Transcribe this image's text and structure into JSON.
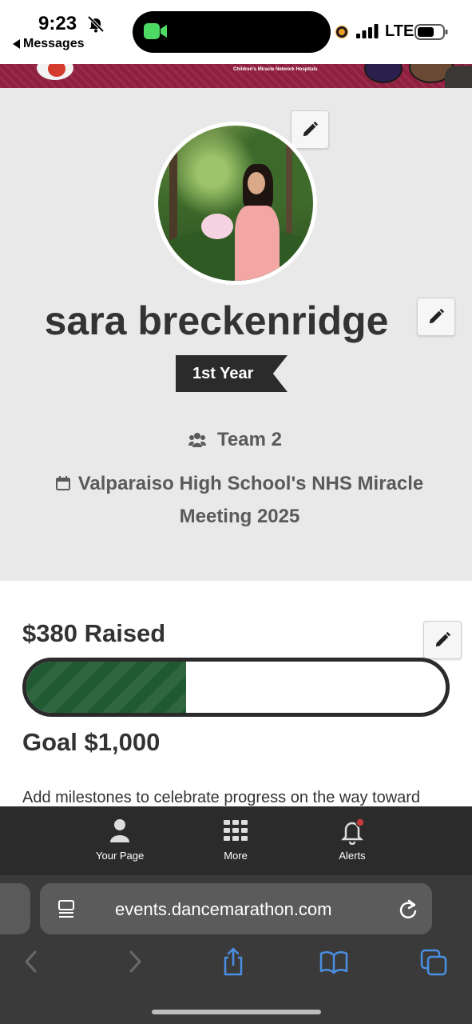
{
  "status_bar": {
    "time": "9:23",
    "back_app": "Messages",
    "network": "LTE"
  },
  "banner": {
    "small_text": "Children's Miracle Network Hospitals",
    "brand_color": "#8f1f3f"
  },
  "profile": {
    "name": "sara breckenridge",
    "year_badge": "1st Year",
    "team": "Team 2",
    "event": "Valparaiso High School's NHS Miracle Meeting 2025"
  },
  "fundraising": {
    "raised_label": "$380 Raised",
    "goal_label": "Goal $1,000",
    "progress_fraction": 0.38,
    "progress_color": "#1f5a32",
    "milestone_text": "Add milestones to celebrate progress on the way toward"
  },
  "app_nav": {
    "items": [
      {
        "label": "Your Page",
        "icon": "person-icon"
      },
      {
        "label": "More",
        "icon": "grid-icon"
      },
      {
        "label": "Alerts",
        "icon": "bell-icon"
      }
    ]
  },
  "browser": {
    "url": "events.dancemarathon.com"
  }
}
